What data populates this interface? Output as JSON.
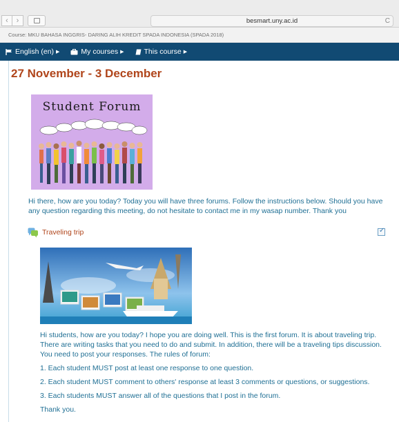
{
  "browser": {
    "back": "‹",
    "forward": "›",
    "url": "besmart.uny.ac.id",
    "reload": "C"
  },
  "course": {
    "breadcrumb": "Course: MKU BAHASA INGGRIS- DARING ALIH KREDIT SPADA INDONESIA (SPADA 2018)"
  },
  "menu": [
    {
      "icon": "flag-icon",
      "label": "English (en)"
    },
    {
      "icon": "courses-icon",
      "label": "My courses"
    },
    {
      "icon": "book-icon",
      "label": "This course"
    }
  ],
  "week": {
    "title": "27 November - 3 December"
  },
  "forum_image": {
    "title": "Student Forum"
  },
  "intro": "Hi there, how are you today? Today you will have three forums. Follow the instructions below. Should you have any question regarding this meeting, do not hesitate to contact me in my wasap number. Thank you",
  "activity": {
    "icon": "forum-icon",
    "title": "Traveling trip",
    "completion": "checked"
  },
  "description": {
    "text": "Hi students, how are you today? I hope you are doing well. This is the first forum. It is about traveling trip. There are writing tasks that you need to do and submit. In addition, there will be a traveling tips discussion. You need to post your responses. The rules of forum:",
    "rules": [
      "1. Each student MUST post at least one response to one question.",
      "2. Each student MUST comment to others' response at least 3 comments or questions, or suggestions.",
      "3. Each students MUST answer all of the questions that I post in the forum."
    ],
    "closing": "Thank you."
  },
  "colors": {
    "menu_bg": "#114a73",
    "accent": "#b0451b",
    "text": "#1f6f94"
  }
}
